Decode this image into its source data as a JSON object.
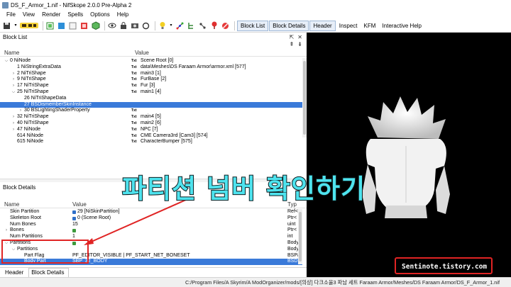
{
  "window": {
    "title": "DS_F_Armor_1.nif - NifSkope 2.0.0 Pre-Alpha 2"
  },
  "menu": [
    "File",
    "View",
    "Render",
    "Spells",
    "Options",
    "Help"
  ],
  "toolbar": {
    "icons": [
      "save-icon",
      "chevron-down-icon",
      "logo-icon",
      "new-block-icon",
      "flat-icon",
      "shaded-icon",
      "textures-icon",
      "3d-icon",
      "eye-icon",
      "lock-icon",
      "photo-icon",
      "refresh-icon",
      "light-icon",
      "lights-menu-icon",
      "axes-icon",
      "tree-icon",
      "node-icon",
      "pin-icon",
      "block-icon"
    ],
    "toggles": [
      {
        "label": "Block List",
        "active": true
      },
      {
        "label": "Block Details",
        "active": true
      },
      {
        "label": "Header",
        "active": true
      },
      {
        "label": "Inspect",
        "active": false
      },
      {
        "label": "KFM",
        "active": false
      },
      {
        "label": "Interactive Help",
        "active": false
      }
    ]
  },
  "block_list": {
    "title": "Block List",
    "col_name": "Name",
    "col_value": "Value",
    "rows": [
      {
        "indent": 0,
        "expander": "down",
        "name": "0 NiNode",
        "tx": "Txt",
        "value": "Scene Root [0]",
        "sel": false
      },
      {
        "indent": 1,
        "expander": "",
        "name": "1 NiStringExtraData",
        "tx": "Txt",
        "value": "data\\Meshes\\DS Faraam Armor\\armor.xml [577]",
        "sel": false
      },
      {
        "indent": 1,
        "expander": "right",
        "name": "2 NiTriShape",
        "tx": "Txt",
        "value": "main3 [1]",
        "sel": false
      },
      {
        "indent": 1,
        "expander": "right",
        "name": "9 NiTriShape",
        "tx": "Txt",
        "value": "FurBase [2]",
        "sel": false
      },
      {
        "indent": 1,
        "expander": "right",
        "name": "17 NiTriShape",
        "tx": "Txt",
        "value": "Fur [3]",
        "sel": false
      },
      {
        "indent": 1,
        "expander": "down",
        "name": "25 NiTriShape",
        "tx": "Txt",
        "value": "main1 [4]",
        "sel": false
      },
      {
        "indent": 2,
        "expander": "",
        "name": "26 NiTriShapeData",
        "tx": "",
        "value": "",
        "sel": false
      },
      {
        "indent": 2,
        "expander": "",
        "name": "27 BSDismemberSkinInstance",
        "tx": "",
        "value": "",
        "sel": true
      },
      {
        "indent": 2,
        "expander": "right",
        "name": "30 BSLightingShaderProperty",
        "tx": "Txt",
        "value": "",
        "sel": false
      },
      {
        "indent": 1,
        "expander": "right",
        "name": "32 NiTriShape",
        "tx": "Txt",
        "value": "main4 [5]",
        "sel": false
      },
      {
        "indent": 1,
        "expander": "right",
        "name": "40 NiTriShape",
        "tx": "Txt",
        "value": "main2 [6]",
        "sel": false
      },
      {
        "indent": 1,
        "expander": "right",
        "name": "47 NiNode",
        "tx": "Txt",
        "value": "NPC [7]",
        "sel": false
      },
      {
        "indent": 1,
        "expander": "",
        "name": "614 NiNode",
        "tx": "Txt",
        "value": "CME Camera3rd [Cam3] [574]",
        "sel": false
      },
      {
        "indent": 1,
        "expander": "",
        "name": "615 NiNode",
        "tx": "Txt",
        "value": "CharacterBumper [575]",
        "sel": false
      }
    ]
  },
  "block_details": {
    "title": "Block Details",
    "col_name": "Name",
    "col_value": "Value",
    "col_type": "Typ",
    "rows": [
      {
        "indent": 0,
        "expander": "",
        "name": "Skin Partition",
        "icon": "b",
        "value": "29 [NiSkinPartition]",
        "type": "Ref<",
        "sel": false
      },
      {
        "indent": 0,
        "expander": "",
        "name": "Skeleton Root",
        "icon": "b",
        "value": "0 (Scene Root)",
        "type": "Ptr<",
        "sel": false
      },
      {
        "indent": 0,
        "expander": "",
        "name": "Num Bones",
        "icon": "",
        "value": "15",
        "type": "uint",
        "sel": false
      },
      {
        "indent": 0,
        "expander": "right",
        "name": "Bones",
        "icon": "g",
        "value": "",
        "type": "Ptr<",
        "sel": false
      },
      {
        "indent": 0,
        "expander": "",
        "name": "Num Partitions",
        "icon": "",
        "value": "1",
        "type": "int",
        "sel": false
      },
      {
        "indent": 0,
        "expander": "down",
        "name": "Partitions",
        "icon": "g",
        "value": "",
        "type": "Body",
        "sel": false
      },
      {
        "indent": 1,
        "expander": "down",
        "name": "Partitions",
        "icon": "",
        "value": "",
        "type": "Body",
        "sel": false
      },
      {
        "indent": 2,
        "expander": "",
        "name": "Part Flag",
        "icon": "",
        "value": "PF_EDITOR_VISIBLE | PF_START_NET_BONESET",
        "type": "BSPa",
        "sel": false
      },
      {
        "indent": 2,
        "expander": "",
        "name": "Body Part",
        "icon": "",
        "value": "SBP_32_BODY",
        "type": "BSD",
        "sel": true
      }
    ]
  },
  "bottom_tabs": [
    {
      "label": "Header",
      "active": false
    },
    {
      "label": "Block Details",
      "active": true
    }
  ],
  "status": {
    "path": "C:/Program Files/A Skyrim/A ModOrganizer/mods/[의상] 다크소울3 파남 세트 Faraam Armor/Meshes/DS Faraam Armor/DS_F_Armor_1.nif"
  },
  "overlay": {
    "caption": "파티션 넘버 확인하기",
    "watermark": "Sentinote.tistory.com"
  },
  "colors": {
    "selection": "#3a7ad9",
    "accent_annotation": "#e02424",
    "caption": "#4ee3ee"
  }
}
